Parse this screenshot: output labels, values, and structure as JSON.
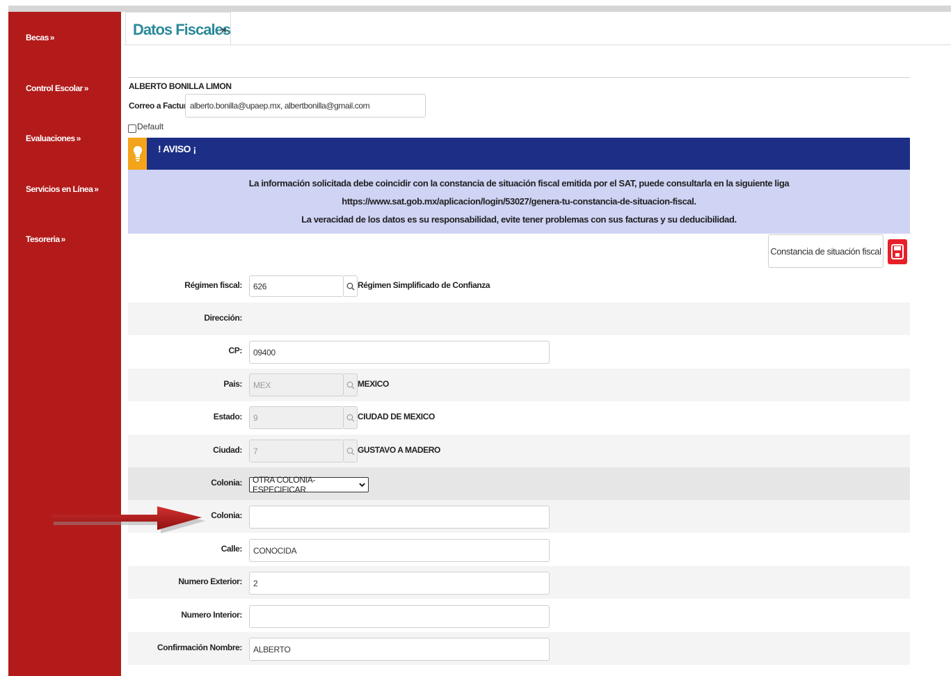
{
  "sidebar": {
    "items": [
      {
        "label": "Becas",
        "chevron": "»"
      },
      {
        "label": "Control Escolar",
        "chevron": "»"
      },
      {
        "label": "Evaluaciones",
        "chevron": "»"
      },
      {
        "label": "Servicios en Línea",
        "chevron": "»"
      },
      {
        "label": "Tesoreria",
        "chevron": "»"
      }
    ]
  },
  "tab": {
    "title": "Datos Fiscales",
    "close": "×"
  },
  "person": {
    "name": "ALBERTO BONILLA LIMON",
    "correo_label": "Correo a Facturar:",
    "correo_value": "alberto.bonilla@upaep.mx, albertbonilla@gmail.com",
    "default_label": "Default"
  },
  "aviso": {
    "title": "! AVISO ¡",
    "line1": "La información solicitada debe coincidir con la constancia de situación fiscal emitida por el SAT, puede consultarla en la siguiente liga",
    "line2": "https://www.sat.gob.mx/aplicacion/login/53027/genera-tu-constancia-de-situacion-fiscal.",
    "line3": "La veracidad de los datos es su responsabilidad, evite tener problemas con sus facturas y su deducibilidad."
  },
  "actions": {
    "constancia_label": "Constancia de situación fiscal"
  },
  "form": {
    "regimen": {
      "label": "Régimen fiscal:",
      "value": "626",
      "desc": "Régimen Simplificado de Confianza"
    },
    "direccion": {
      "label": "Dirección:"
    },
    "cp": {
      "label": "CP:",
      "value": "09400"
    },
    "pais": {
      "label": "Pais:",
      "value": "MEX",
      "desc": "MEXICO"
    },
    "estado": {
      "label": "Estado:",
      "value": "9",
      "desc": "CIUDAD DE MEXICO"
    },
    "ciudad": {
      "label": "Ciudad:",
      "value": "7",
      "desc": "GUSTAVO A MADERO"
    },
    "colonia_select": {
      "label": "Colonia:",
      "value": "OTRA COLONIA-ESPECIFICAR"
    },
    "colonia_text": {
      "label": "Colonia:",
      "value": ""
    },
    "calle": {
      "label": "Calle:",
      "value": "CONOCIDA"
    },
    "num_ext": {
      "label": "Numero Exterior:",
      "value": "2"
    },
    "num_int": {
      "label": "Numero Interior:",
      "value": ""
    },
    "confirmacion": {
      "label": "Confirmación Nombre:",
      "value": "ALBERTO"
    }
  },
  "colors": {
    "sidebar": "#b31b1b",
    "aviso_header": "#1d2e86",
    "aviso_body": "#cfd3f4",
    "tab_title": "#2c8a9a",
    "save_button": "#e8202a",
    "annotation_arrow": "#b01717"
  },
  "icons": {
    "aviso": "lightbulb-icon",
    "save": "floppy-disk-icon",
    "lookup": "search-icon",
    "annotation": "red-arrow-icon"
  }
}
